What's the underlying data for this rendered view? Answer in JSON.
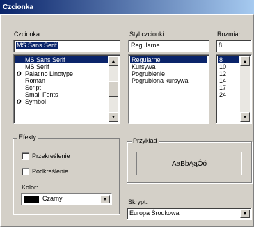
{
  "dialog": {
    "title": "Czcionka"
  },
  "font": {
    "label": "Czcionka:",
    "value": "MS Sans Serif",
    "items": [
      {
        "name": "MS Sans Serif",
        "glyph": "",
        "selected": true
      },
      {
        "name": "MS Serif",
        "glyph": "",
        "selected": false
      },
      {
        "name": "Palatino Linotype",
        "glyph": "O",
        "selected": false
      },
      {
        "name": "Roman",
        "glyph": "",
        "selected": false
      },
      {
        "name": "Script",
        "glyph": "",
        "selected": false
      },
      {
        "name": "Small Fonts",
        "glyph": "",
        "selected": false
      },
      {
        "name": "Symbol",
        "glyph": "O",
        "selected": false
      }
    ]
  },
  "style": {
    "label": "Styl czcionki:",
    "value": "Regularne",
    "items": [
      {
        "name": "Regularne",
        "selected": true
      },
      {
        "name": "Kursywa",
        "selected": false
      },
      {
        "name": "Pogrubienie",
        "selected": false
      },
      {
        "name": "Pogrubiona kursywa",
        "selected": false
      }
    ]
  },
  "size": {
    "label": "Rozmiar:",
    "value": "8",
    "items": [
      {
        "name": "8",
        "selected": true
      },
      {
        "name": "10",
        "selected": false
      },
      {
        "name": "12",
        "selected": false
      },
      {
        "name": "14",
        "selected": false
      },
      {
        "name": "17",
        "selected": false
      },
      {
        "name": "24",
        "selected": false
      }
    ]
  },
  "effects": {
    "title": "Efekty",
    "strikeout_label": "Przekreślenie",
    "strikeout_checked": false,
    "underline_label": "Podkreślenie",
    "underline_checked": false,
    "color_label": "Kolor:",
    "color_value": "Czarny",
    "color_hex": "#000000"
  },
  "sample": {
    "title": "Przykład",
    "text": "AaBbĄąÓó"
  },
  "script": {
    "label": "Skrypt:",
    "value": "Europa Środkowa"
  },
  "colors": {
    "selection": "#0a246a",
    "face": "#d4d0c8"
  }
}
